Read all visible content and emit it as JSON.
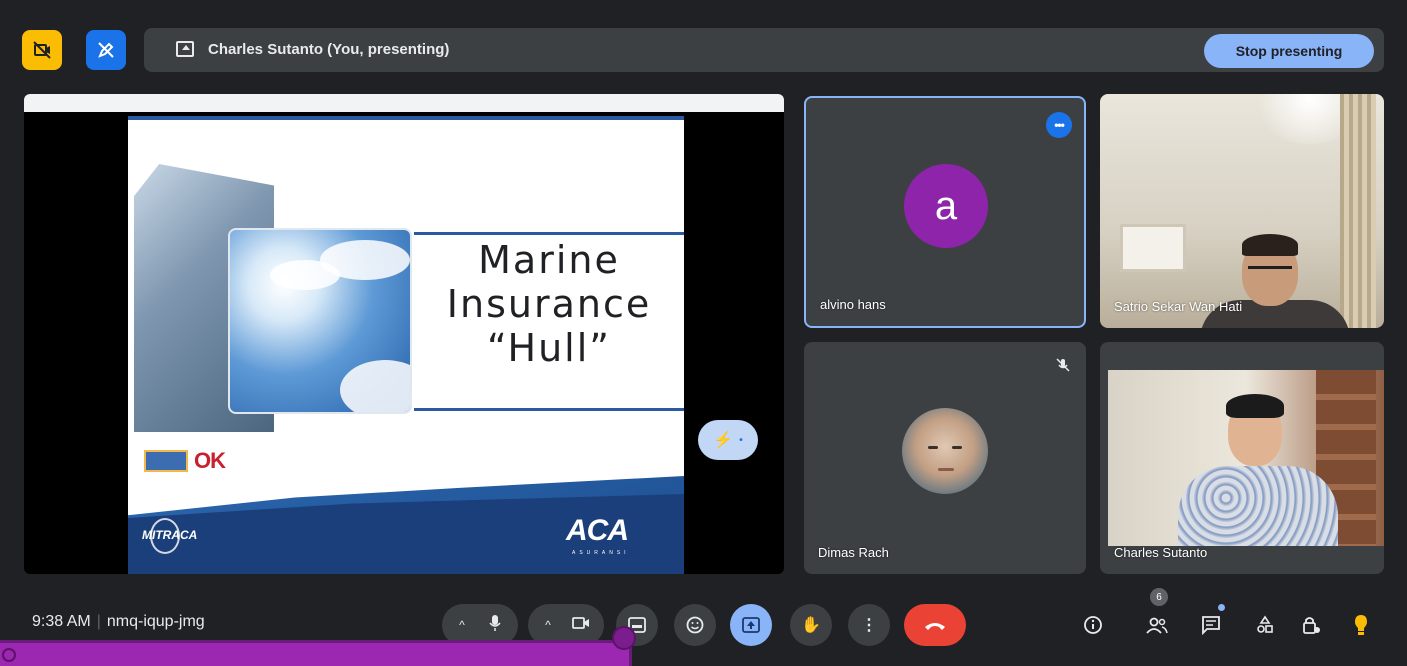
{
  "topbar": {
    "presenting_label": "Charles Sutanto (You, presenting)",
    "stop_label": "Stop presenting"
  },
  "slide": {
    "title_line1": "Marine",
    "title_line2": "Insurance",
    "title_line3": "“Hull”",
    "logo_ojk": "OK",
    "logo_mitraca": "MITRACA",
    "logo_aca": "ACA",
    "logo_aca_sub": "ASURANSI"
  },
  "participants": [
    {
      "name": "alvino hans",
      "initial": "a"
    },
    {
      "name": "Satrio Sekar Wan Hati"
    },
    {
      "name": "Dimas Rach"
    },
    {
      "name": "Charles Sutanto"
    }
  ],
  "bottombar": {
    "time": "9:38 AM",
    "meeting_code": "nmq-iqup-jmg",
    "people_count": "6"
  },
  "colors": {
    "background": "#202124",
    "accent_blue": "#8ab4f8",
    "end_call_red": "#ea4335",
    "avatar_purple": "#8e24aa",
    "overlay_purple": "#9c27b0"
  }
}
